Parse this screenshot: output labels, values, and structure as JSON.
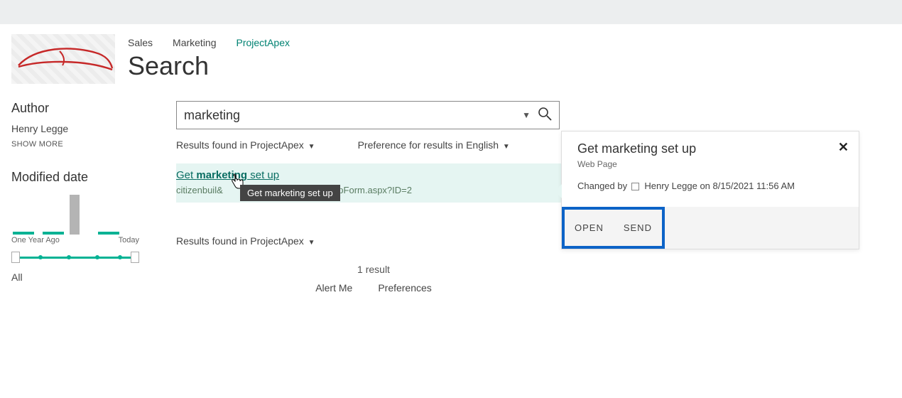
{
  "nav": {
    "tabs": [
      "Sales",
      "Marketing",
      "ProjectApex"
    ],
    "active_index": 2
  },
  "page": {
    "title": "Search"
  },
  "sidebar": {
    "author_heading": "Author",
    "author_name": "Henry Legge",
    "show_more": "SHOW MORE",
    "mod_heading": "Modified date",
    "histo_left": "One Year Ago",
    "histo_right": "Today",
    "facet_all": "All"
  },
  "search": {
    "query": "marketing"
  },
  "meta": {
    "scope_prefix": "Results found in ",
    "scope_value": "ProjectApex",
    "pref_prefix": "Preference for results in ",
    "pref_value": "English"
  },
  "result": {
    "link_pre": "Get ",
    "link_hl": "marketing",
    "link_post": " set up",
    "url_visible": "citizenbuil&",
    "url_tail": "/…/Tasks/DispForm.aspx?ID=2",
    "tooltip": "Get marketing set up"
  },
  "lower": {
    "scope_prefix": "Results found in ",
    "scope_value": "ProjectApex"
  },
  "footer": {
    "count": "1 result",
    "alert": "Alert Me",
    "prefs": "Preferences"
  },
  "callout": {
    "title": "Get marketing set up",
    "subtitle": "Web Page",
    "changed_by_label": "Changed by",
    "changed_by_name": "Henry Legge",
    "changed_on_label": "on",
    "changed_on": "8/15/2021 11:56 AM",
    "open": "OPEN",
    "send": "SEND"
  }
}
